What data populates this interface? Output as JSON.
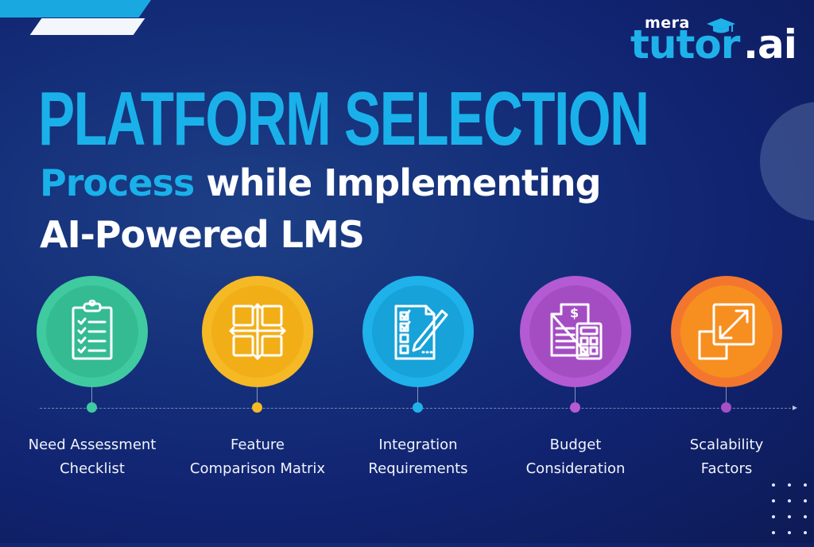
{
  "brand": {
    "prefix": "mera",
    "name": "tutor",
    "suffix": ".ai",
    "colors": {
      "primary": "#1ab1ea",
      "white": "#ffffff",
      "background": "#122776"
    }
  },
  "heading": {
    "line1": "PLATFORM SELECTION",
    "line2_accent": "Process",
    "line2_rest": " while Implementing",
    "line3": "AI-Powered LMS"
  },
  "steps": [
    {
      "label_line1": "Need Assessment",
      "label_line2": "Checklist",
      "icon": "clipboard-checklist-icon",
      "color": "#3fcb9f",
      "color_inner": "#33b98f"
    },
    {
      "label_line1": "Feature",
      "label_line2": "Comparison Matrix",
      "icon": "grid-arrows-icon",
      "color": "#f5b925",
      "color_inner": "#f0ac12"
    },
    {
      "label_line1": "Integration",
      "label_line2": "Requirements",
      "icon": "checklist-pencil-icon",
      "color": "#1fb2ea",
      "color_inner": "#16a1da"
    },
    {
      "label_line1": "Budget",
      "label_line2": "Consideration",
      "icon": "invoice-calculator-icon",
      "color": "#b45bd3",
      "color_inner": "#a34cc2"
    },
    {
      "label_line1": "Scalability",
      "label_line2": "Factors",
      "icon": "resize-scale-icon",
      "color": "#f3762f",
      "color_inner": "#f6901f"
    }
  ]
}
